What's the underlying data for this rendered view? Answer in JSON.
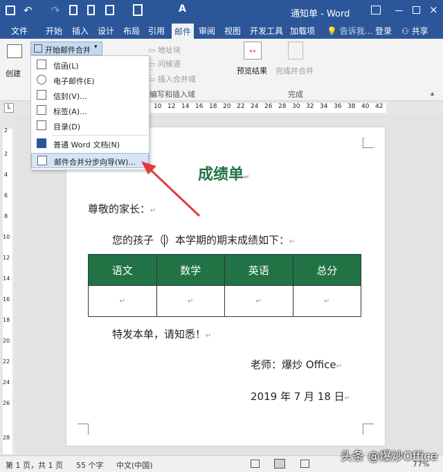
{
  "titlebar": {
    "title": "通知单 - Word"
  },
  "tabs": [
    "文件",
    "开始",
    "插入",
    "设计",
    "布局",
    "引用",
    "邮件",
    "审阅",
    "视图",
    "开发工具",
    "加载项"
  ],
  "tell_me": "告诉我...",
  "login": "登录",
  "share": "共享",
  "ribbon": {
    "create": "创建",
    "start_merge": "开始邮件合并",
    "address_block": "地址块",
    "greeting": "问候语",
    "insert_field": "插入合并域",
    "preview": "预览结果",
    "finish_merge": "完成并合并",
    "group_write": "编写和插入域",
    "group_finish": "完成"
  },
  "menu": {
    "items": [
      "信函(L)",
      "电子邮件(E)",
      "信封(V)...",
      "标签(A)...",
      "目录(D)",
      "普通 Word 文档(N)",
      "邮件合并分步向导(W)..."
    ]
  },
  "ruler": {
    "ticks": [
      "10",
      "12",
      "14",
      "16",
      "18",
      "20",
      "22",
      "24",
      "26",
      "28",
      "30",
      "32",
      "34",
      "36",
      "38",
      "40",
      "42"
    ]
  },
  "vruler": {
    "ticks": [
      "2",
      "2",
      "4",
      "6",
      "8",
      "10",
      "12",
      "14",
      "16",
      "18",
      "20",
      "22",
      "24",
      "26",
      "28"
    ]
  },
  "doc": {
    "title": "成绩单",
    "greeting": "尊敬的家长：",
    "intro_a": "您的孩子（",
    "intro_b": "）本学期的期末成绩如下：",
    "table_headers": [
      "语文",
      "数学",
      "英语",
      "总分"
    ],
    "closing": "特发本单，请知悉！",
    "teacher": "老师：爆炒 Office",
    "date": "2019 年 7 月 18 日"
  },
  "status": {
    "page": "第 1 页，共 1 页",
    "words": "55 个字",
    "lang": "中文(中国)",
    "zoom": "77%"
  },
  "watermark": "头条 @爆炒Office",
  "colors": {
    "brand": "#2b579a",
    "table_header": "#217346",
    "arrow": "#e03c3c"
  }
}
